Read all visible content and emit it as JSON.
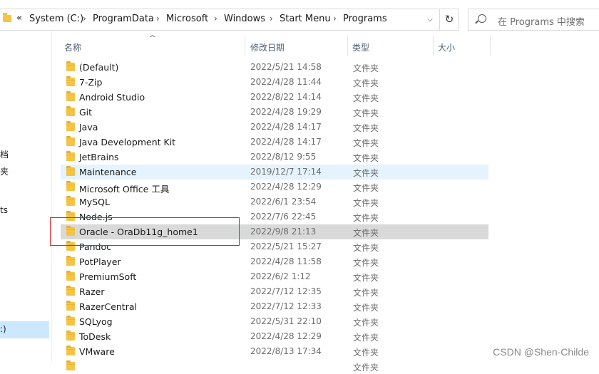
{
  "address": {
    "overflow": "«",
    "crumbs": [
      "System (C:)",
      "ProgramData",
      "Microsoft",
      "Windows",
      "Start Menu",
      "Programs"
    ],
    "separator": "›",
    "dropdown": "⌵",
    "refresh": "↻"
  },
  "search": {
    "placeholder": "在 Programs 中搜索"
  },
  "nav": {
    "fragments": [
      "档",
      "夹",
      "ts"
    ],
    "selected": ":)"
  },
  "columns": {
    "name": "名称",
    "modified": "修改日期",
    "type": "类型",
    "size": "大小",
    "sort_indicator": "^"
  },
  "files": [
    {
      "name": "(Default)",
      "modified": "2022/5/21 14:58",
      "type": "文件夹"
    },
    {
      "name": "7-Zip",
      "modified": "2022/4/28 11:44",
      "type": "文件夹"
    },
    {
      "name": "Android Studio",
      "modified": "2022/8/22 14:14",
      "type": "文件夹"
    },
    {
      "name": "Git",
      "modified": "2022/4/28 19:29",
      "type": "文件夹"
    },
    {
      "name": "Java",
      "modified": "2022/4/28 14:17",
      "type": "文件夹"
    },
    {
      "name": "Java Development Kit",
      "modified": "2022/4/28 14:17",
      "type": "文件夹"
    },
    {
      "name": "JetBrains",
      "modified": "2022/8/12 9:55",
      "type": "文件夹"
    },
    {
      "name": "Maintenance",
      "modified": "2019/12/7 17:14",
      "type": "文件夹"
    },
    {
      "name": "Microsoft Office 工具",
      "modified": "2022/4/28 12:29",
      "type": "文件夹"
    },
    {
      "name": "MySQL",
      "modified": "2022/6/1 23:54",
      "type": "文件夹"
    },
    {
      "name": "Node.js",
      "modified": "2022/7/6 22:45",
      "type": "文件夹"
    },
    {
      "name": "Oracle - OraDb11g_home1",
      "modified": "2022/9/8 21:13",
      "type": "文件夹"
    },
    {
      "name": "Pandoc",
      "modified": "2022/5/21 15:27",
      "type": "文件夹"
    },
    {
      "name": "PotPlayer",
      "modified": "2022/4/28 11:58",
      "type": "文件夹"
    },
    {
      "name": "PremiumSoft",
      "modified": "2022/6/2 1:12",
      "type": "文件夹"
    },
    {
      "name": "Razer",
      "modified": "2022/7/12 12:35",
      "type": "文件夹"
    },
    {
      "name": "RazerCentral",
      "modified": "2022/7/12 12:33",
      "type": "文件夹"
    },
    {
      "name": "SQLyog",
      "modified": "2022/5/31 22:10",
      "type": "文件夹"
    },
    {
      "name": "ToDesk",
      "modified": "2022/4/28 12:29",
      "type": "文件夹"
    },
    {
      "name": "VMware",
      "modified": "2022/8/13 17:34",
      "type": "文件夹"
    },
    {
      "name": "",
      "modified": "",
      "type": "文件夹"
    }
  ],
  "hovered_index": 7,
  "selected_index": 11,
  "watermark": "CSDN @Shen-Childe",
  "colors": {
    "folder": "#f5c445",
    "hover": "#e5f3ff",
    "selected": "#d9d9d9",
    "highlight_box": "#d9252a",
    "nav_selected": "#cce8ff"
  }
}
